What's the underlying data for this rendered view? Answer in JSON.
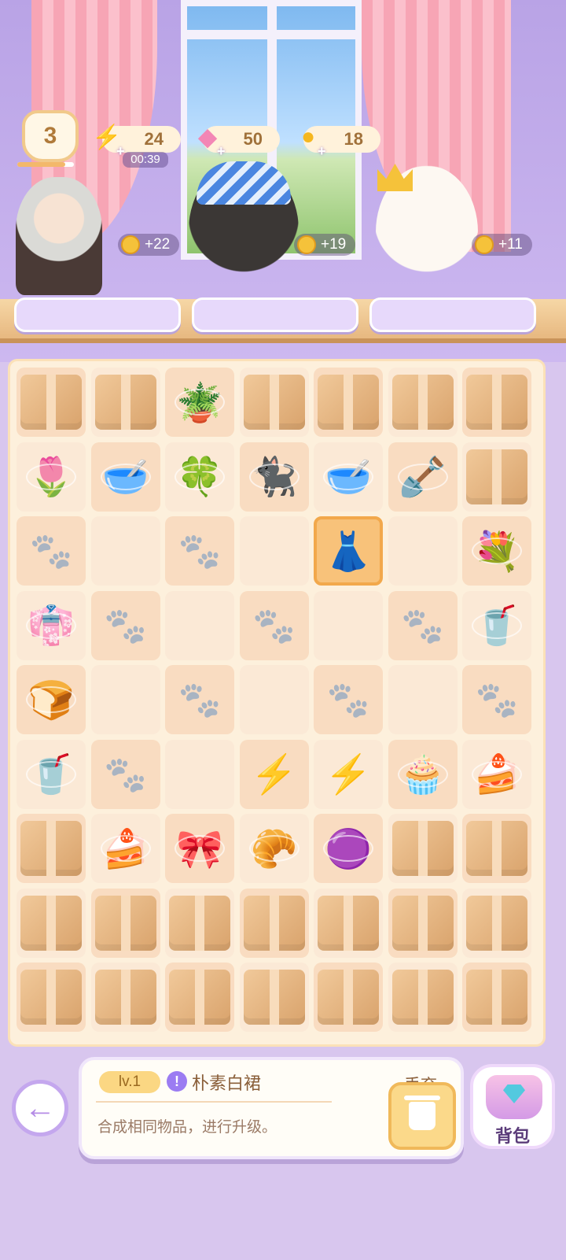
{
  "player": {
    "level": "3",
    "level_progress": 0.85
  },
  "resources": {
    "energy": {
      "icon": "lightning-icon",
      "value": "24",
      "timer": "00:39"
    },
    "gems": {
      "icon": "pink-gem-icon",
      "value": "50"
    },
    "coins": {
      "icon": "coin-icon",
      "value": "18"
    }
  },
  "customers": [
    {
      "name": "granny",
      "reward": "+22"
    },
    {
      "name": "black-cat",
      "reward": "+19"
    },
    {
      "name": "white-cat",
      "reward": "+11"
    }
  ],
  "selected_item": {
    "level": "lv.1",
    "name": "朴素白裙",
    "description": "合成相同物品，进行升级。"
  },
  "buttons": {
    "discard": "丢弃",
    "bag": "背包"
  },
  "board": {
    "rows": [
      [
        "box",
        "box",
        "watering-can",
        "box",
        "box",
        "box",
        "box"
      ],
      [
        "tulip",
        "pet-bowl-brown",
        "clover",
        "cat-figure",
        "pet-bowl-teal",
        "shovel",
        "box"
      ],
      [
        "empty-paw",
        "empty",
        "empty-paw",
        "empty",
        "white-dress",
        "empty",
        "lavender-bouquet"
      ],
      [
        "pink-dress",
        "empty-paw",
        "empty",
        "empty-paw",
        "empty",
        "empty-paw",
        "iced-drink"
      ],
      [
        "cat-bread",
        "empty",
        "empty-paw",
        "empty",
        "empty-paw",
        "empty",
        "empty-paw"
      ],
      [
        "iced-drink",
        "empty-paw",
        "empty",
        "energy-bottle",
        "energy-shell",
        "cupcake",
        "fruit-cake"
      ],
      [
        "box",
        "fruit-cake",
        "ribbon",
        "round-bread",
        "purple-gem",
        "box",
        "box"
      ],
      [
        "box",
        "box",
        "box",
        "box",
        "box",
        "box",
        "box"
      ],
      [
        "box",
        "box",
        "box",
        "box",
        "box",
        "box",
        "box"
      ]
    ],
    "selected": [
      2,
      4
    ]
  }
}
